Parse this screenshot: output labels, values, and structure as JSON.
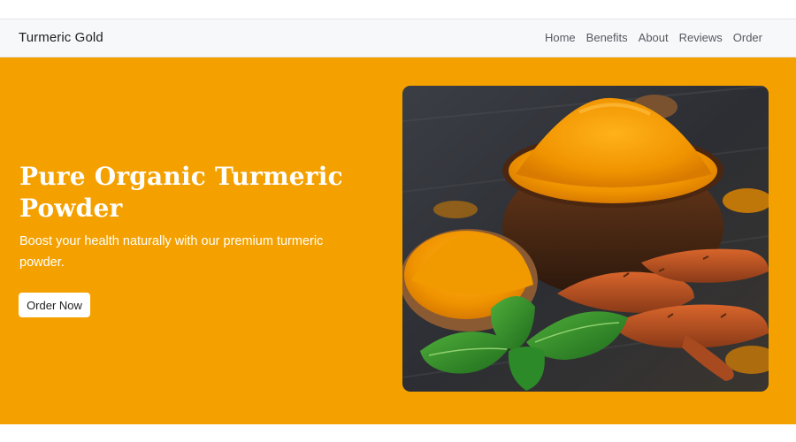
{
  "navbar": {
    "brand": "Turmeric Gold",
    "links": [
      "Home",
      "Benefits",
      "About",
      "Reviews",
      "Order"
    ]
  },
  "hero": {
    "title": "Pure Organic Turmeric Powder",
    "subtitle": "Boost your health naturally with our premium turmeric powder.",
    "cta_label": "Order Now",
    "image_alt": "Turmeric powder in a bowl with fresh turmeric roots and basil leaves"
  },
  "colors": {
    "hero_background": "#f4a100",
    "navbar_background": "#f7f8fa",
    "button_background": "#ffffff"
  }
}
